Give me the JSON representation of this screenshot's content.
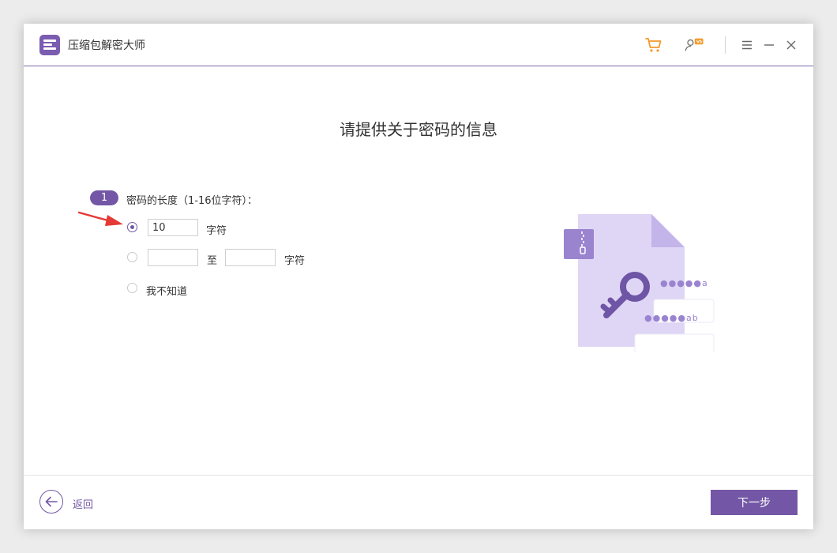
{
  "app": {
    "title": "压缩包解密大师"
  },
  "titlebar": {
    "icons": [
      "cart-icon",
      "user-vip-icon",
      "menu-icon",
      "minimize-icon",
      "close-icon"
    ],
    "cart_color": "#f39a2b"
  },
  "main": {
    "heading": "请提供关于密码的信息",
    "step": {
      "number": "1",
      "label": "密码的长度（1-16位字符）："
    },
    "options": {
      "exact": {
        "value": "10",
        "unit": "字符",
        "selected": true
      },
      "range": {
        "from": "",
        "separator": "至",
        "to": "",
        "unit": "字符",
        "selected": false
      },
      "unknown": {
        "label": "我不知道",
        "selected": false
      }
    },
    "illustration": {
      "masked_line1": "●●●●●a",
      "masked_line2": "●●●●●ab",
      "icons": [
        "zip-file-icon",
        "key-icon"
      ]
    }
  },
  "footer": {
    "back_label": "返回",
    "next_label": "下一步"
  },
  "colors": {
    "accent": "#7357a6",
    "arrow": "#e53935",
    "illustration_bg": "#dfd6f6"
  }
}
